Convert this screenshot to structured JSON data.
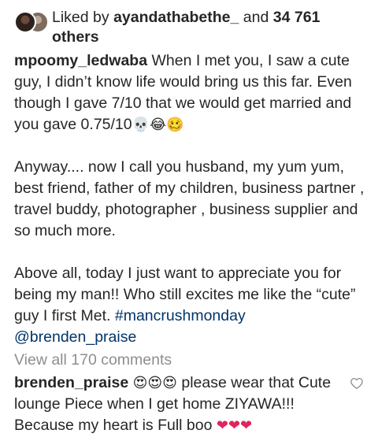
{
  "likes": {
    "prefix": "Liked by",
    "user": "ayandathabethe_",
    "connector": "and",
    "count": "34 761",
    "suffix": "others"
  },
  "post": {
    "author": "mpoomy_ledwaba",
    "paragraph1": "When I met you, I saw a cute guy, I didn’t know life would bring us this far. Even though I gave 7/10 that we would get married and you gave 0.75/10",
    "paragraph1_emojis": "💀😂🥴",
    "paragraph2": "Anyway.... now I call you husband, my yum yum, best friend, father of my children, business partner , travel buddy, photographer , business supplier and so much more.",
    "paragraph3": "Above all, today I just want to appreciate you for being my man!! Who still excites me like the “cute” guy I first Met.",
    "hashtag": "#mancrushmonday",
    "mention": "@brenden_praise"
  },
  "comments": {
    "view_all": "View all 170 comments",
    "items": [
      {
        "user": "brenden_praise",
        "emojis_before": "😍😍😍",
        "text": "please wear that Cute lounge Piece when I get home ZIYAWA!!! Because my heart is Full boo",
        "emojis_after": "❤❤❤"
      }
    ]
  },
  "icons": {
    "like_comment": "heart-outline-icon"
  },
  "colors": {
    "text": "#262626",
    "link": "#003569",
    "muted": "#8e8e8e"
  }
}
